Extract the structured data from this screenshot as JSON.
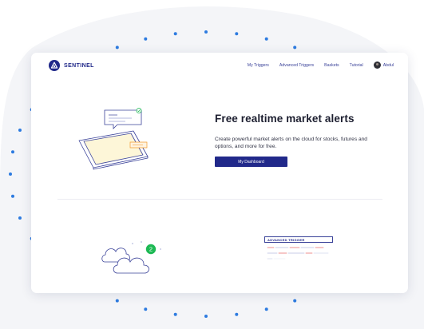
{
  "brand": {
    "name": "SENTINEL",
    "color": "#21298a"
  },
  "nav": {
    "links": [
      "My Triggers",
      "Advanced Triggers",
      "Baskets",
      "Tutorial"
    ],
    "user": {
      "name": "Abdul",
      "avatar_icon": "user-avatar"
    }
  },
  "hero": {
    "title": "Free realtime market alerts",
    "subtitle": "Create powerful market alerts on the cloud for stocks, futures and options, and more for free.",
    "cta_label": "My Dashboard"
  },
  "feature": {
    "cloud_badge": "2",
    "trigger_header": "ADVANCED TRIGGER"
  },
  "colors": {
    "accent": "#21298a",
    "dots": "#2d7be0",
    "badge_green": "#1db954",
    "illustration_line": "#3a4299"
  }
}
